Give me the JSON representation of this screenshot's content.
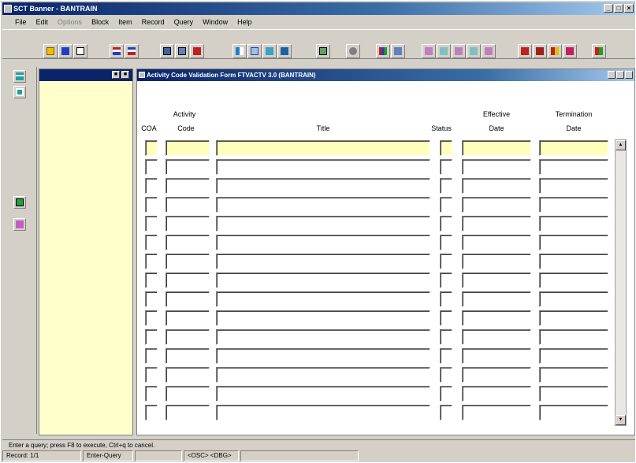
{
  "window": {
    "title": "SCT Banner - BANTRAIN"
  },
  "menu": [
    "File",
    "Edit",
    "Options",
    "Block",
    "Item",
    "Record",
    "Query",
    "Window",
    "Help"
  ],
  "menu_disabled": [
    "Options"
  ],
  "form": {
    "title": "Activity Code Validation Form FTVACTV 3.0 (BANTRAIN)",
    "columns": {
      "coa": "COA",
      "activity_top": "Activity",
      "activity_bottom": "Code",
      "title": "Title",
      "status": "Status",
      "effective_top": "Effective",
      "effective_bottom": "Date",
      "termination_top": "Termination",
      "termination_bottom": "Date"
    },
    "row_count": 15
  },
  "status": {
    "message": "Enter a query; press F8 to execute, Ctrl+q to cancel.",
    "record": "Record: 1/1",
    "mode": "Enter-Query",
    "osc": "<OSC> <DBG>"
  },
  "colors": {
    "title_bar": "#0a246a",
    "nav_panel": "#ffffcc",
    "highlight_row": "#ffffbb"
  }
}
